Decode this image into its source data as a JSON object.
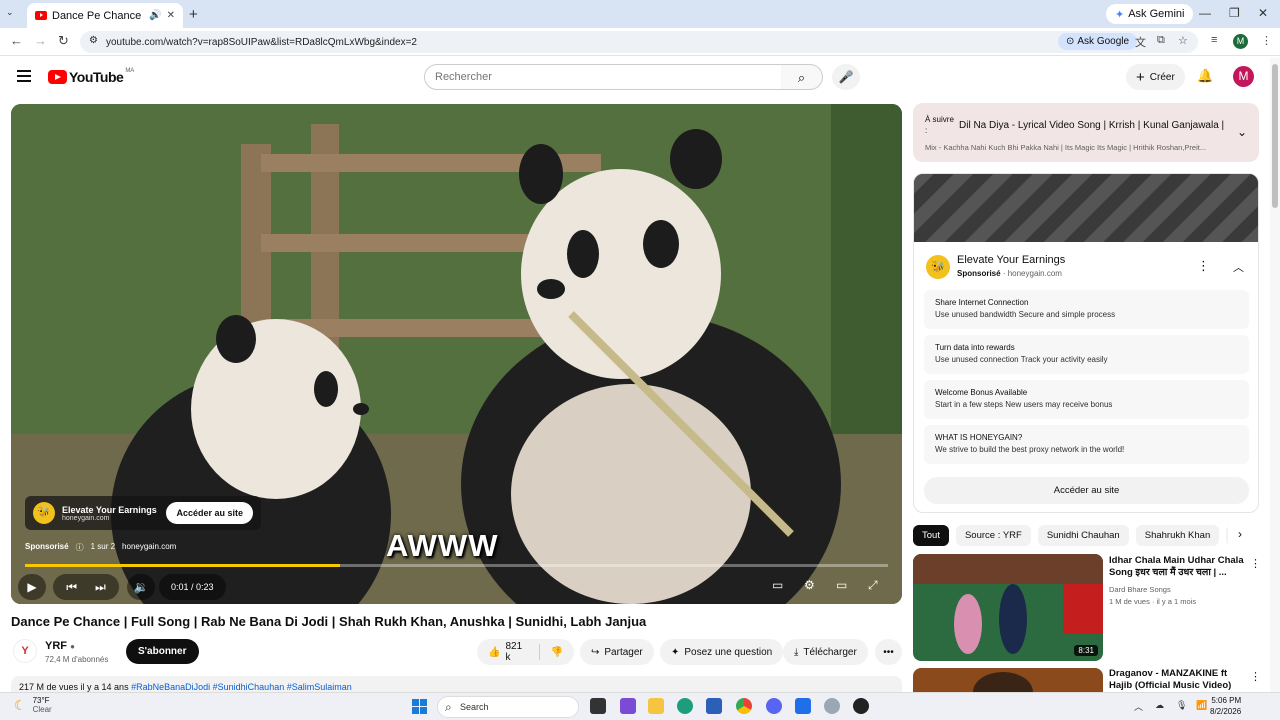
{
  "browser": {
    "tab_title": "Dance Pe Chance | Full Son",
    "url": "youtube.com/watch?v=rap8SoUIPaw&list=RDa8lcQmLxWbg&index=2",
    "ask_google": "Ask Google",
    "ask_gemini": "Ask Gemini",
    "profile_initial": "M"
  },
  "header": {
    "logo_text": "YouTube",
    "country_code": "MA",
    "search_placeholder": "Rechercher",
    "create_label": "Créer",
    "avatar_initial": "M"
  },
  "player": {
    "ad_name": "Elevate Your Earnings",
    "ad_domain": "honeygain.com",
    "ad_visit_label": "Accéder au site",
    "ad_sponsored": "Sponsorisé",
    "ad_count": "1 sur 2",
    "ad_meta_domain": "honeygain.com",
    "caption": "AWWW",
    "time": "0:01 / 0:23",
    "progress": 0.365
  },
  "video": {
    "title": "Dance Pe Chance | Full Song | Rab Ne Bana Di Jodi | Shah Rukh Khan, Anushka | Sunidhi, Labh Janjua",
    "channel": "YRF",
    "subscribers": "72,4 M d'abonnés",
    "subscribe_label": "S'abonner",
    "likes": "821 k",
    "share_label": "Partager",
    "ask_label": "Posez une question",
    "download_label": "Télécharger",
    "description_stats": "217 M de vues  il y a 14 ans",
    "description_tags": "#RabNeBanaDiJodi #SunidhiChauhan #SalimSulaiman"
  },
  "up_next": {
    "label": "À suivre :",
    "title": "Dil Na Diya - Lyrical Video Song | Krrish | Kunal Ganjawala | Hri...",
    "subtitle": "Mix - Kachha Nahi Kuch Bhi Pakka Nahi | Its Magic Its Magic | Hrithik Roshan,Preit..."
  },
  "ad_panel": {
    "name": "Elevate Your Earnings",
    "sponsored": "Sponsorisé",
    "domain": "· honeygain.com",
    "features": [
      {
        "heading": "Share Internet Connection",
        "detail": "Use unused bandwidth Secure and simple process"
      },
      {
        "heading": "Turn data into rewards",
        "detail": "Use unused connection Track your activity easily"
      },
      {
        "heading": "Welcome Bonus Available",
        "detail": "Start in a few steps New users may receive bonus"
      },
      {
        "heading": "WHAT IS HONEYGAIN?",
        "detail": "We strive to build the best proxy network in the world!"
      }
    ],
    "button_label": "Accéder au site"
  },
  "chips": [
    "Tout",
    "Source : YRF",
    "Sunidhi Chauhan",
    "Shahrukh Khan",
    "Mu"
  ],
  "recommendations": [
    {
      "title": "Idhar Chala Main Udhar Chala Song इधर चला मैं उधर चला | ...",
      "channel": "Dard Bhare Songs",
      "stats": "1 M de vues · il y a 1 mois",
      "duration": "8:31",
      "thumb_color": "#2c6b3f"
    },
    {
      "title": "Draganov - MANZAKINE ft Hajib (Official Music Video)",
      "channel": "",
      "stats": "",
      "duration": "",
      "thumb_color": "#8a4a1c"
    }
  ],
  "taskbar": {
    "temperature": "73°F",
    "condition": "Clear",
    "search_label": "Search",
    "time": "5:06 PM",
    "date": "8/2/2026"
  }
}
